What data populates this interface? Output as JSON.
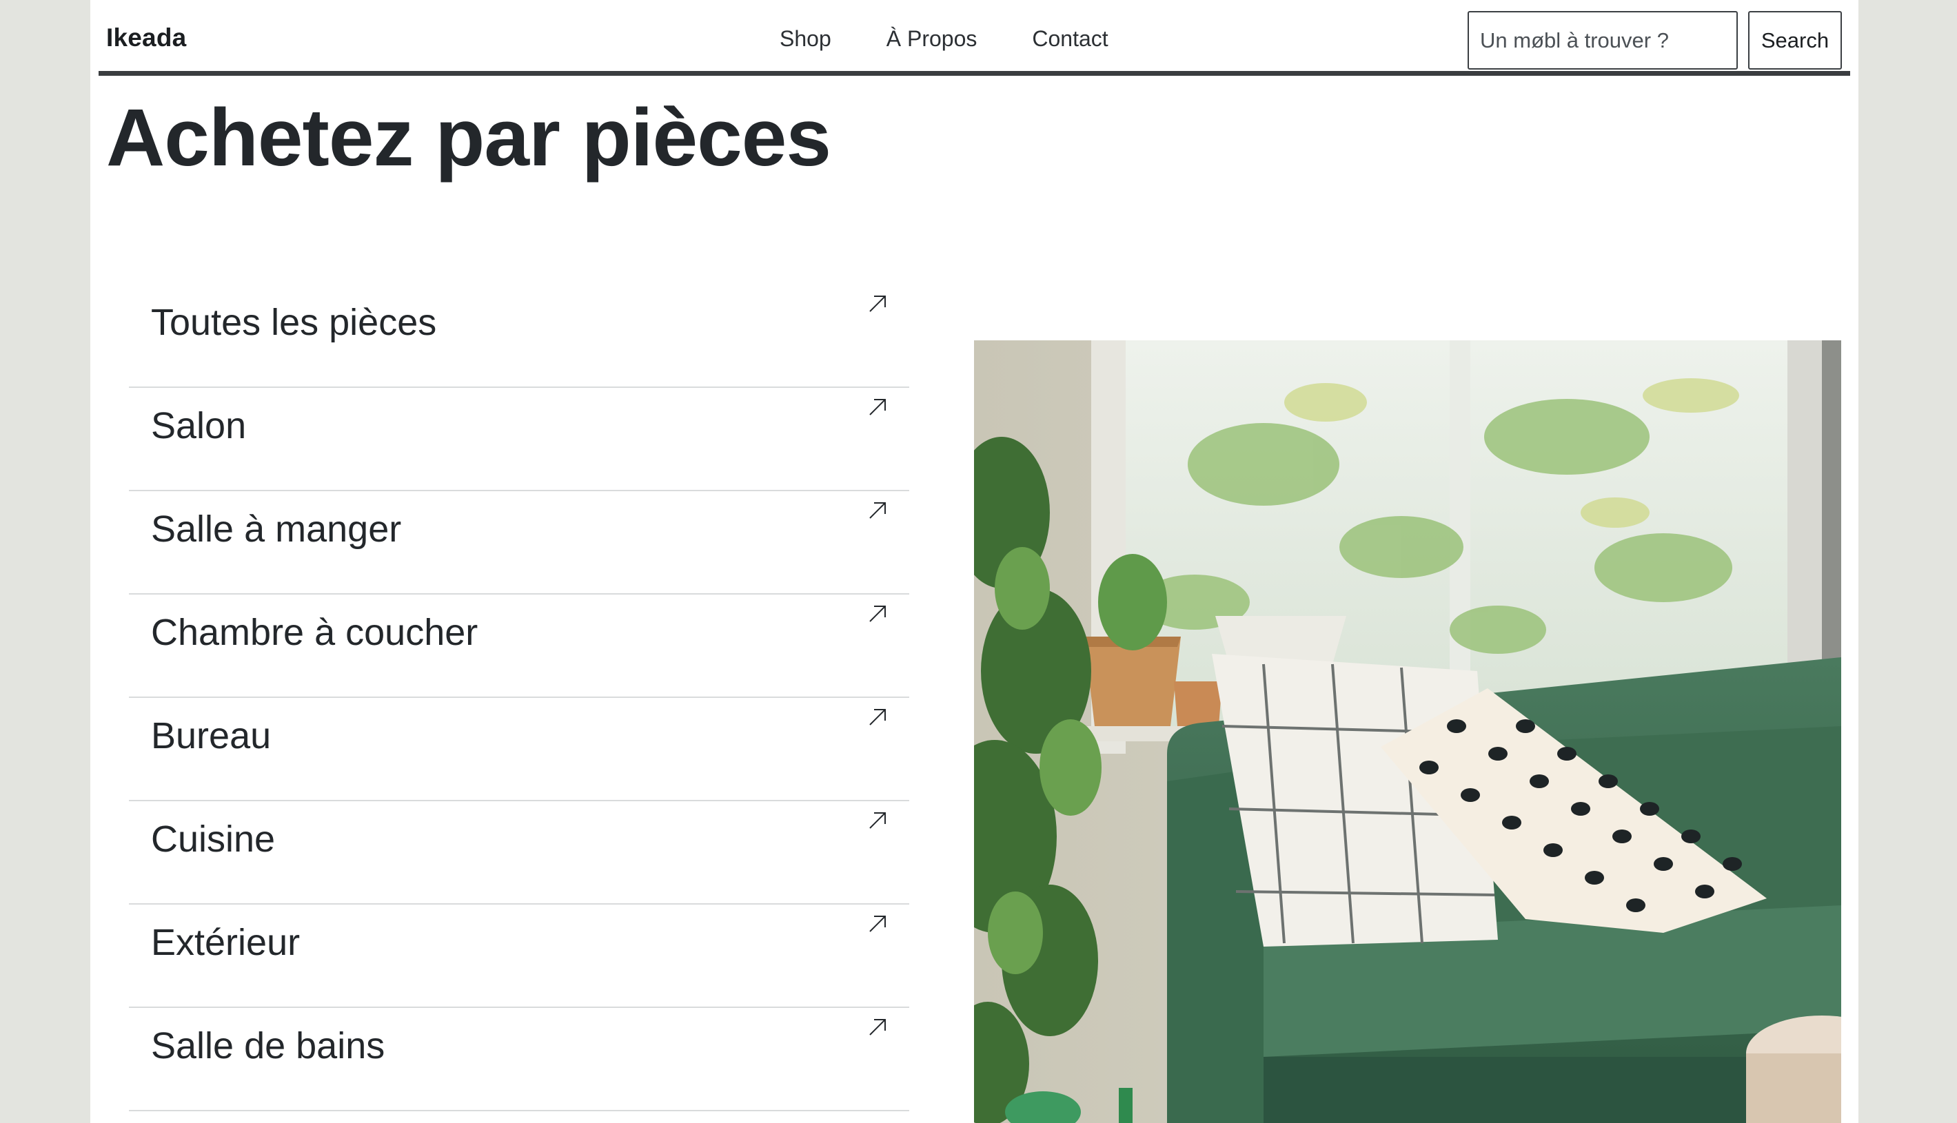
{
  "header": {
    "logo": "Ikeada",
    "nav": [
      "Shop",
      "À Propos",
      "Contact"
    ],
    "search": {
      "placeholder": "Un møbl à trouver ?",
      "value": "",
      "button_label": "Search"
    }
  },
  "main": {
    "title": "Achetez par pièces",
    "rooms": [
      {
        "label": "Toutes les pièces",
        "icon": "arrow-up-right-icon"
      },
      {
        "label": "Salon",
        "icon": "arrow-up-right-icon"
      },
      {
        "label": "Salle à manger",
        "icon": "arrow-up-right-icon"
      },
      {
        "label": "Chambre à coucher",
        "icon": "arrow-up-right-icon"
      },
      {
        "label": "Bureau",
        "icon": "arrow-up-right-icon"
      },
      {
        "label": "Cuisine",
        "icon": "arrow-up-right-icon"
      },
      {
        "label": "Extérieur",
        "icon": "arrow-up-right-icon"
      },
      {
        "label": "Salle de bains",
        "icon": "arrow-up-right-icon"
      }
    ],
    "hero_image": {
      "subject": "green sofa with patterned cushions and plants by a window"
    }
  },
  "colors": {
    "page_background": "#e3e4df",
    "content_background": "#ffffff",
    "text": "#1f2326",
    "header_rule": "#3a3d40",
    "sofa_green": "#3f6b52"
  }
}
